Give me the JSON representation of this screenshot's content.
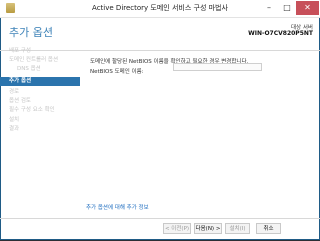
{
  "window": {
    "title": "Active Directory 도메인 서비스 구성 마법사",
    "min_glyph": "–",
    "max_glyph": "□",
    "close_glyph": "✕"
  },
  "header": {
    "page_title": "추가 옵션",
    "target_label": "대상 서버",
    "target_server": "WIN-O7CV820P5NT"
  },
  "sidebar": {
    "items": [
      {
        "label": "배포 구성"
      },
      {
        "label": "도메인 컨트롤러 옵션"
      },
      {
        "label": "DNS 옵션"
      },
      {
        "label": "추가 옵션"
      },
      {
        "label": "경로"
      },
      {
        "label": "옵션 검토"
      },
      {
        "label": "필수 구성 요소 확인"
      },
      {
        "label": "설치"
      },
      {
        "label": "결과"
      }
    ]
  },
  "main": {
    "description": "도메인에 할당된 NetBIOS 이름을 확인하고 필요한 경우 변경합니다.",
    "netbios_label": "NetBIOS 도메인 이름:",
    "netbios_value": "",
    "help_link": "추가 옵션에 대해 추가 정보"
  },
  "footer": {
    "prev": "< 이전(P)",
    "next": "다음(N) >",
    "install": "설치(I)",
    "cancel": "취소"
  }
}
